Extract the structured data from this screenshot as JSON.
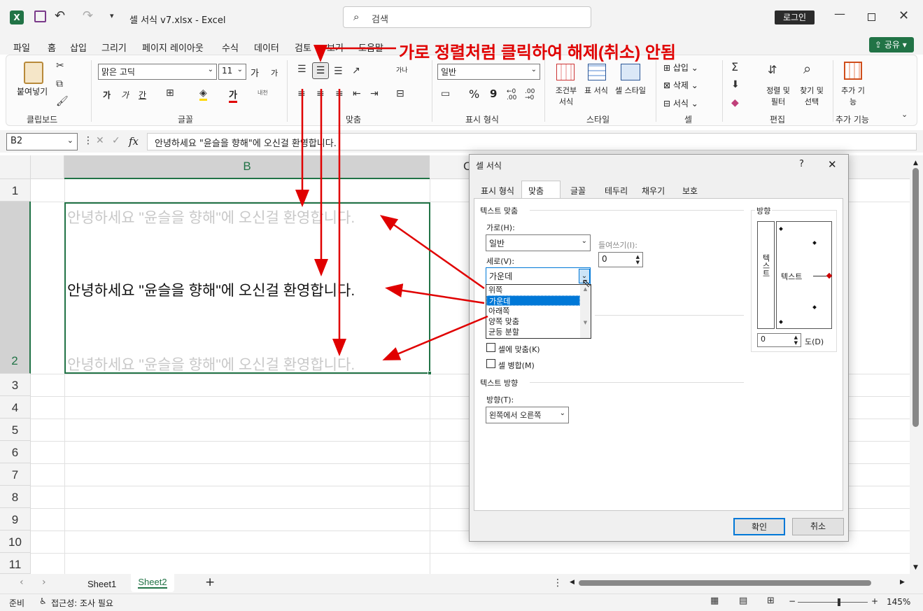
{
  "titlebar": {
    "filename": "셀 서식 v7.xlsx",
    "separator": "-",
    "app": "Excel",
    "search_placeholder": "검색",
    "login": "로그인"
  },
  "menu": {
    "items": [
      "파일",
      "홈",
      "삽입",
      "그리기",
      "페이지 레이아웃",
      "수식",
      "데이터",
      "검토",
      "보기",
      "도움말"
    ],
    "share": "공유"
  },
  "ribbon": {
    "clipboard": {
      "paste": "붙여넣기",
      "group": "클립보드"
    },
    "font": {
      "name": "맑은 고딕",
      "size": "11",
      "bold": "가",
      "italic": "가",
      "underline": "간",
      "grow": "가",
      "shrink": "가",
      "phonetic": "내천",
      "fontcolor": "가",
      "group": "글꼴"
    },
    "align": {
      "wrap": "가나",
      "group": "맞춤"
    },
    "number": {
      "format": "일반",
      "percent": "%",
      "comma": "9",
      "inc": "←0 .00",
      "dec": ".00 →0",
      "group": "표시 형식"
    },
    "styles": {
      "cond": "조건부 서식",
      "table": "표 서식",
      "cell": "셀 스타일",
      "group": "스타일"
    },
    "cells": {
      "insert": "삽입",
      "delete": "삭제",
      "format": "서식",
      "group": "셀"
    },
    "edit": {
      "sort": "정렬 및 필터",
      "find": "찾기 및 선택",
      "group": "편집"
    },
    "addins": {
      "label": "추가 기능",
      "group": "추가 기능"
    }
  },
  "formula": {
    "namebox": "B2",
    "fx": "fx",
    "content": "안녕하세요 \"윤슬을 향해\"에 오신걸 환영합니다."
  },
  "grid": {
    "colB": "B",
    "colC": "C",
    "rows": [
      "1",
      "2",
      "3",
      "4",
      "5",
      "6",
      "7",
      "8",
      "9",
      "10",
      "11"
    ],
    "cell_b2": "안녕하세요 \"윤슬을 향해\"에 오신걸 환영합니다."
  },
  "annotation": {
    "text": "가로 정렬처럼 클릭하여 해제(취소) 안됨"
  },
  "dialog": {
    "title": "셀 서식",
    "help": "?",
    "close": "✕",
    "tabs": [
      "표시 형식",
      "맞춤",
      "글꼴",
      "테두리",
      "채우기",
      "보호"
    ],
    "text_align_section": "텍스트 맞춤",
    "horizontal_label": "가로(H):",
    "horizontal_value": "일반",
    "indent_label": "들여쓰기(I):",
    "indent_value": "0",
    "vertical_label": "세로(V):",
    "vertical_value": "가운데",
    "vertical_options": [
      "위쪽",
      "가운데",
      "아래쪽",
      "양쪽 맞춤",
      "균등 분할"
    ],
    "shrink_fit": "셀에 맞춤(K)",
    "merge": "셀 병합(M)",
    "direction_section": "텍스트 방향",
    "direction_label": "방향(T):",
    "direction_value": "왼쪽에서 오른쪽",
    "orientation_section": "방향",
    "orientation_vertical": "텍스트",
    "orientation_horizontal": "텍스트",
    "degree_value": "0",
    "degree_label": "도(D)",
    "ok": "확인",
    "cancel": "취소"
  },
  "sheets": {
    "tabs": [
      "Sheet1",
      "Sheet2"
    ],
    "add": "+"
  },
  "status": {
    "ready": "준비",
    "accessibility": "접근성: 조사 필요",
    "zoom": "145%"
  },
  "colors": {
    "excel_green": "#217346",
    "annotation_red": "#e00000",
    "dialog_bg": "#f0f0f0",
    "dropdown_highlight": "#0078d7"
  }
}
